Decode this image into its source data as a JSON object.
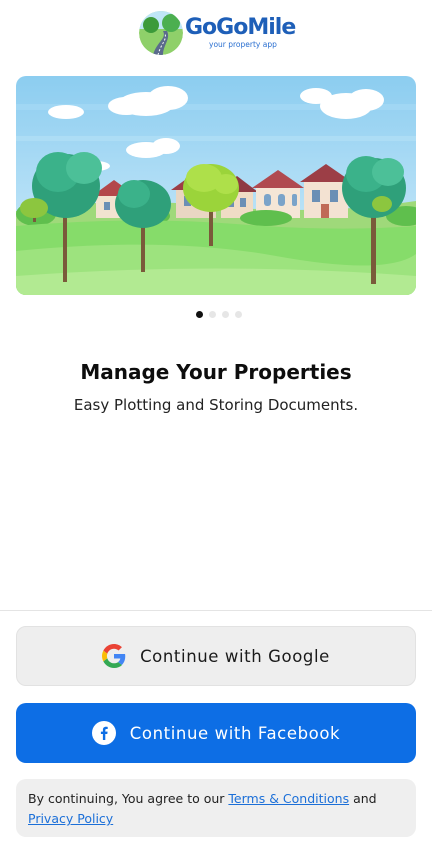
{
  "app": {
    "name": "GoGoMile",
    "tagline": "your property app"
  },
  "carousel": {
    "slide_count": 4,
    "active_index": 0
  },
  "onboarding": {
    "title": "Manage Your Properties",
    "subtitle": "Easy Plotting and Storing Documents."
  },
  "auth": {
    "google_label": "Continue with Google",
    "facebook_label": "Continue with Facebook"
  },
  "legal": {
    "prefix": "By continuing, You agree to our ",
    "terms_link": "Terms & Conditions",
    "conjunction": " and",
    "privacy_link": "Privacy Policy"
  },
  "colors": {
    "brand_blue": "#1e5fb8",
    "facebook_blue": "#0d6ee5",
    "link_blue": "#1b6fd8"
  },
  "icons": {
    "google": "google-icon",
    "facebook": "facebook-icon"
  }
}
